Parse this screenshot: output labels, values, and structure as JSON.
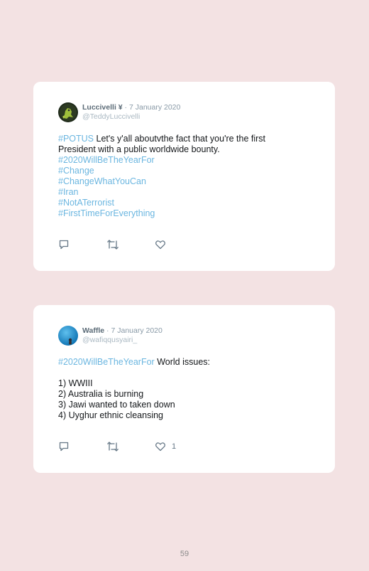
{
  "tweets": [
    {
      "name": "Luccivelli ¥",
      "separator": "·",
      "date": "7 January 2020",
      "handle": "@TeddyLuccivelli",
      "lines": [
        {
          "hashtag": "#POTUS",
          "text": " Let's y'all aboutvthe fact that you're the first"
        },
        {
          "text": "President with a public worldwide bounty."
        },
        {
          "hashtag": "#2020WillBeTheYearFor"
        },
        {
          "hashtag": "#Change"
        },
        {
          "hashtag": "#ChangeWhatYouCan"
        },
        {
          "hashtag": "#Iran"
        },
        {
          "hashtag": "#NotATerrorist"
        },
        {
          "hashtag": "#FirstTimeForEverything"
        }
      ],
      "likes": ""
    },
    {
      "name": "Waffle",
      "separator": "·",
      "date": "7 January 2020",
      "handle": "@wafiqqusyairi_",
      "lines": [
        {
          "hashtag": "#2020WillBeTheYearFor",
          "text": " World issues:"
        },
        {
          "text": ""
        },
        {
          "text": "1) WWIII"
        },
        {
          "text": "2) Australia is burning"
        },
        {
          "text": "3) Jawi wanted to taken down"
        },
        {
          "text": "4) Uyghur ethnic cleansing"
        }
      ],
      "likes": "1"
    }
  ],
  "page_number": "59",
  "colors": {
    "background": "#f3e2e3",
    "card": "#ffffff",
    "hashtag": "#6bb6e0",
    "icon": "#657786"
  },
  "icons": {
    "reply": "reply-icon",
    "retweet": "retweet-icon",
    "like": "heart-icon"
  }
}
